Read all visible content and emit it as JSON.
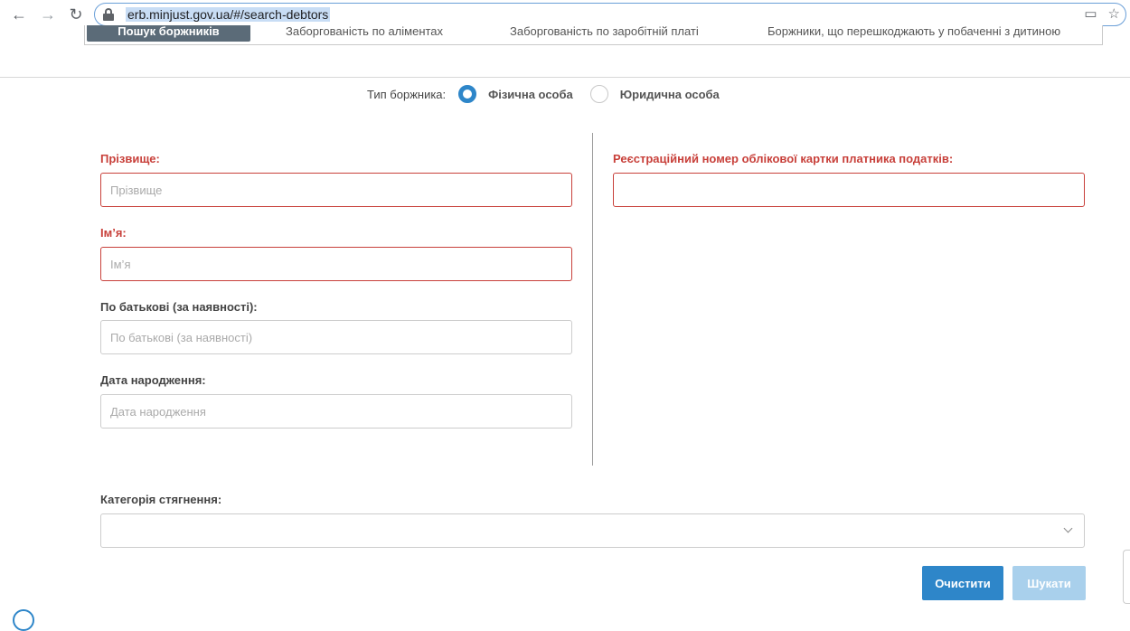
{
  "browser": {
    "url": "erb.minjust.gov.ua/#/search-debtors",
    "back_icon": "arrow-left-icon",
    "forward_icon": "arrow-right-icon",
    "reload_icon": "reload-icon",
    "lock_icon": "lock-icon",
    "cast_icon": "cast-icon",
    "star_icon": "star-icon"
  },
  "tabs": [
    {
      "label": "Пошук боржників",
      "active": true
    },
    {
      "label": "Заборгованість по аліментах",
      "active": false
    },
    {
      "label": "Заборгованість по заробітній платі",
      "active": false
    },
    {
      "label": "Боржники, що перешкоджають у побаченні з дитиною",
      "active": false
    }
  ],
  "debtor_type": {
    "label": "Тип боржника:",
    "options": [
      {
        "label": "Фізична особа",
        "selected": true
      },
      {
        "label": "Юридична особа",
        "selected": false
      }
    ]
  },
  "fields": {
    "surname": {
      "label": "Прізвище:",
      "placeholder": "Прізвище",
      "required": true
    },
    "name": {
      "label": "Ім’я:",
      "placeholder": "Ім’я",
      "required": true
    },
    "patronymic": {
      "label": "По батькові (за наявності):",
      "placeholder": "По батькові (за наявності)",
      "required": false
    },
    "birthdate": {
      "label": "Дата народження:",
      "placeholder": "Дата народження",
      "required": false
    },
    "tax_id": {
      "label": "Реєстраційний номер облікової картки платника податків:",
      "placeholder": "",
      "required": true
    }
  },
  "category": {
    "label": "Категорія стягнення:",
    "selected": ""
  },
  "buttons": {
    "clear": "Очистити",
    "search": "Шукати"
  },
  "colors": {
    "accent": "#2e86c9",
    "accent_disabled": "#a9d0ec",
    "required": "#c8403a",
    "active_tab": "#5b6b78"
  }
}
